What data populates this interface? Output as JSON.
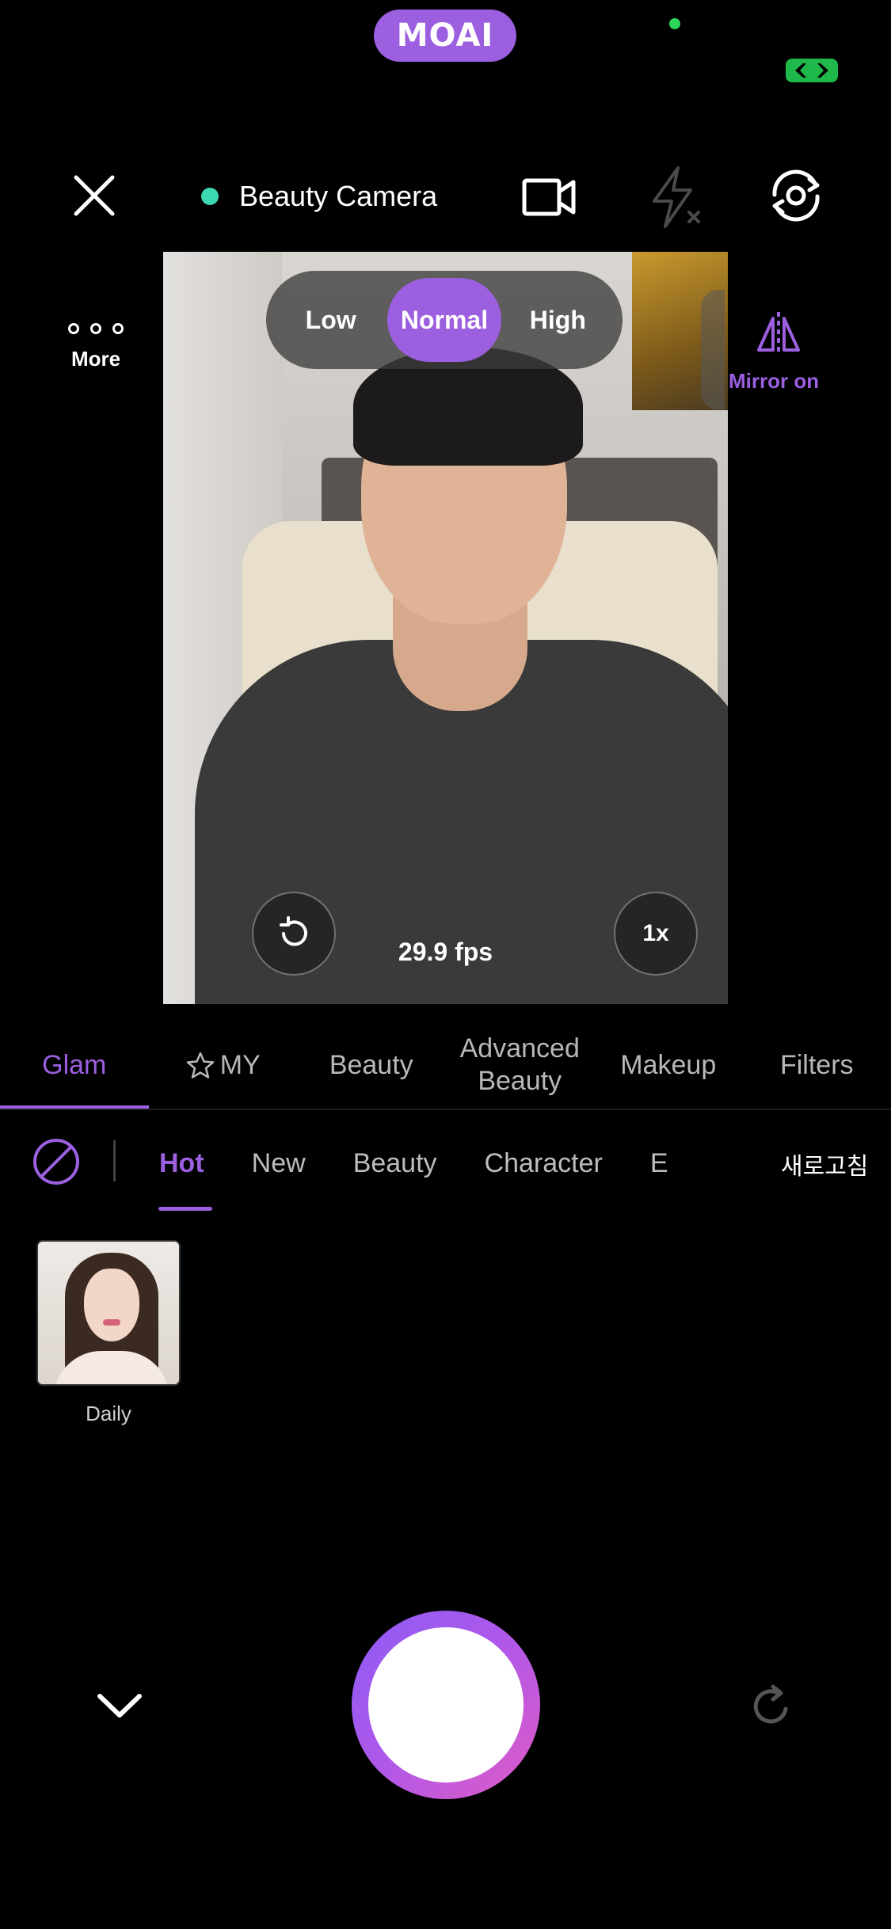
{
  "status": {
    "logo_text": "MOAI",
    "indicator_color": "#2bd65a",
    "badge_icon": "link-icon"
  },
  "top_bar": {
    "close_icon": "close-icon",
    "mode_label": "Beauty Camera",
    "mode_dot_color": "#3dd9b3",
    "video_icon": "video-camera-icon",
    "flash_icon": "flash-off-icon",
    "switch_icon": "switch-camera-icon"
  },
  "intensity": {
    "options": [
      "Low",
      "Normal",
      "High"
    ],
    "selected": "Normal"
  },
  "side": {
    "more_label": "More",
    "mirror_label": "Mirror on"
  },
  "viewport": {
    "fps_label": "29.9 fps",
    "zoom_label": "1x",
    "reset_icon": "undo-icon"
  },
  "main_tabs": {
    "items": [
      "Glam",
      "MY",
      "Beauty",
      "Advanced\nBeauty",
      "Makeup",
      "Filters"
    ],
    "selected": "Glam"
  },
  "sub_tabs": {
    "items": [
      "Hot",
      "New",
      "Beauty",
      "Character",
      "E"
    ],
    "selected": "Hot",
    "refresh_label": "새로고침"
  },
  "gallery": {
    "items": [
      {
        "label": "Daily"
      }
    ]
  },
  "accent_color": "#9b5fe0",
  "shutter_gradient": [
    "#8d5cf6",
    "#e15bc4"
  ]
}
